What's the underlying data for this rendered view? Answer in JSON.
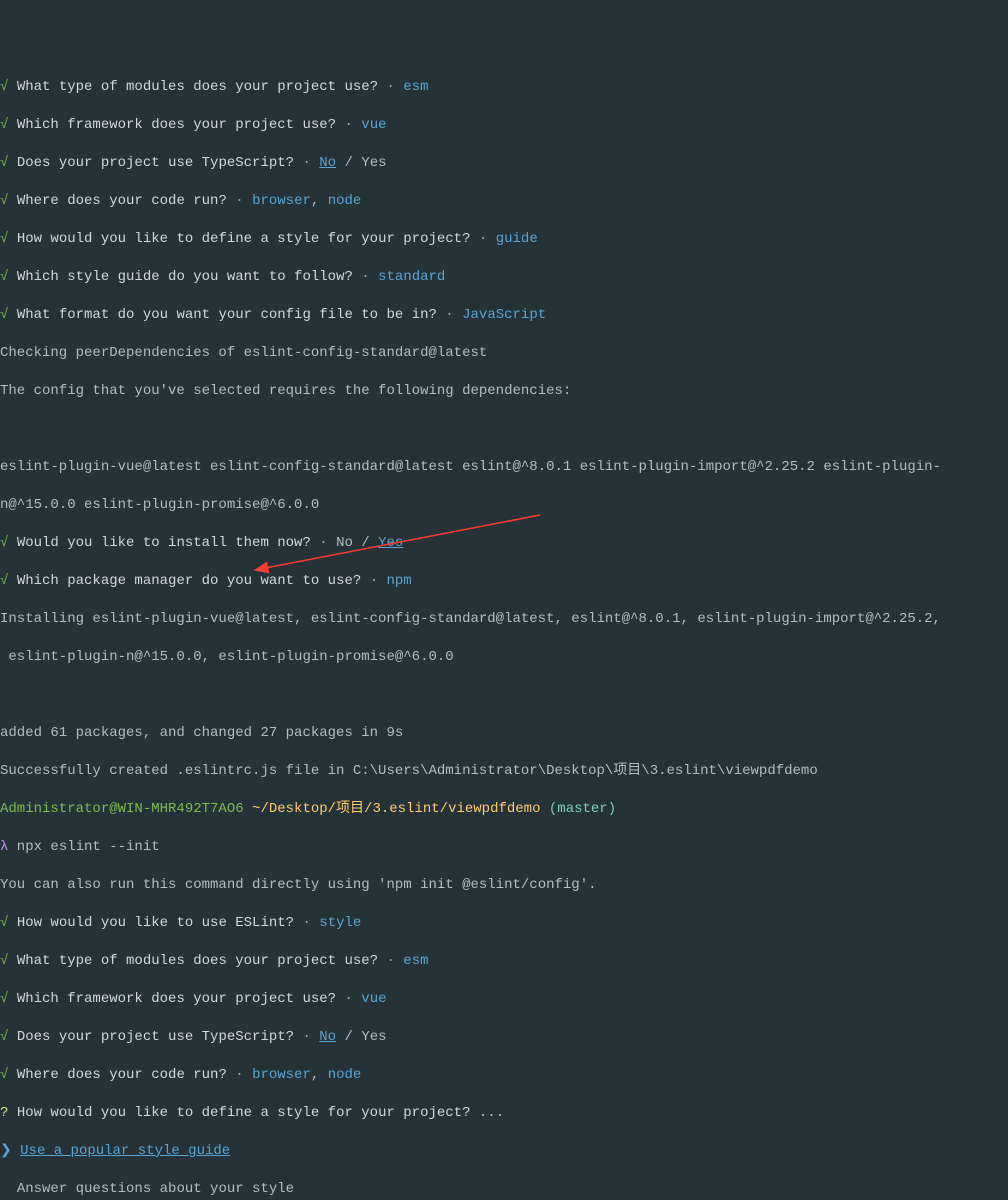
{
  "q1": {
    "prompt": "What type of modules does your project use?",
    "answer": "esm"
  },
  "q2": {
    "prompt": "Which framework does your project use?",
    "answer": "vue"
  },
  "q3": {
    "prompt": "Does your project use TypeScript?",
    "no": "No",
    "yes": "Yes"
  },
  "q4": {
    "prompt": "Where does your code run?",
    "a1": "browser",
    "a2": "node"
  },
  "q5": {
    "prompt": "How would you like to define a style for your project?",
    "answer": "guide"
  },
  "q6": {
    "prompt": "Which style guide do you want to follow?",
    "answer": "standard"
  },
  "q7": {
    "prompt": "What format do you want your config file to be in?",
    "answer": "JavaScript"
  },
  "peer": "Checking peerDependencies of eslint-config-standard@latest",
  "depsIntro": "The config that you've selected requires the following dependencies:",
  "depsLine1": "eslint-plugin-vue@latest eslint-config-standard@latest eslint@^8.0.1 eslint-plugin-import@^2.25.2 eslint-plugin-",
  "depsLine2": "n@^15.0.0 eslint-plugin-promise@^6.0.0",
  "q8": {
    "prompt": "Would you like to install them now?",
    "no": "No",
    "yes": "Yes"
  },
  "q9": {
    "prompt": "Which package manager do you want to use?",
    "answer": "npm"
  },
  "install1": "Installing eslint-plugin-vue@latest, eslint-config-standard@latest, eslint@^8.0.1, eslint-plugin-import@^2.25.2,",
  "install2": " eslint-plugin-n@^15.0.0, eslint-plugin-promise@^6.0.0",
  "added": "added 61 packages, and changed 27 packages in 9s",
  "success": "Successfully created .eslintrc.js file in C:\\Users\\Administrator\\Desktop\\项目\\3.eslint\\viewpdfdemo",
  "prompt": {
    "userhost": "Administrator@WIN-MHR492T7AO6",
    "path": " ~/Desktop/项目/3.eslint/viewpdfdemo ",
    "branch": "(master)"
  },
  "cmd": {
    "lambda": "λ",
    "text": " npx eslint --init"
  },
  "hint": "You can also run this command directly using 'npm init @eslint/config'.",
  "q10": {
    "prompt": "How would you like to use ESLint?",
    "answer": "style"
  },
  "q11": {
    "prompt": "What type of modules does your project use?",
    "answer": "esm"
  },
  "q12": {
    "prompt": "Which framework does your project use?",
    "answer": "vue"
  },
  "q13": {
    "prompt": "Does your project use TypeScript?",
    "no": "No",
    "yes": "Yes"
  },
  "q14": {
    "prompt": "Where does your code run?",
    "a1": "browser",
    "a2": "node"
  },
  "activeQ": "How would you like to define a style for your project?",
  "activeDots": " ...",
  "opt1": "Use a popular style guide",
  "opt2": "Answer questions about your style",
  "glyph": {
    "check": "√",
    "q": "?",
    "cursor": "❯"
  }
}
